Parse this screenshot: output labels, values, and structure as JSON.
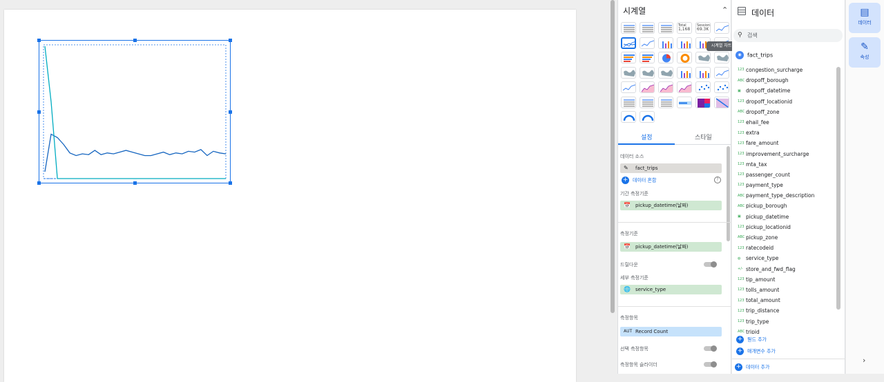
{
  "chart": {
    "chart_data": {
      "type": "line",
      "title": "",
      "xlabel": "",
      "ylabel": "",
      "series": [
        {
          "values": [
            8,
            52,
            48,
            40,
            30,
            27,
            29,
            28,
            33,
            28,
            30,
            29,
            31,
            33,
            31,
            29,
            27,
            27,
            29,
            31,
            28,
            30,
            29,
            32,
            31,
            34,
            27,
            32,
            30,
            29
          ]
        },
        {
          "values": [
            155,
            90,
            0,
            0,
            0,
            0,
            0,
            0,
            0,
            0,
            0,
            0,
            0,
            0,
            0,
            0,
            0,
            0,
            0,
            0,
            0,
            0,
            0,
            0,
            0,
            0,
            0,
            0,
            0,
            0
          ]
        }
      ],
      "colors": [
        "#1565c0",
        "#00acc1"
      ]
    }
  },
  "properties": {
    "title": "시계열",
    "tooltip": "시계열 차트",
    "chart_icons": {
      "scorecard_value_1": "1,168",
      "scorecard_value_2": "69.3K",
      "scorecard_label_1": "Total",
      "scorecard_label_2": "Sessions"
    },
    "tabs": {
      "setup": "설정",
      "style": "스타일"
    },
    "data_source_label": "데이터 소스",
    "data_source": "fact_trips",
    "blend_data": "데이터 혼합",
    "date_range_label": "기간 측정기준",
    "date_range_dimension": "pickup_datetime(날짜)",
    "dimension_label": "측정기준",
    "dimension": "pickup_datetime(날짜)",
    "drill_down_label": "드릴다운",
    "breakdown_label": "세부 측정기준",
    "breakdown": "service_type",
    "metric_label": "측정항목",
    "metric_type": "AUT",
    "metric": "Record Count",
    "optional_metrics_label": "선택 측정항목",
    "metric_sliders_label": "측정항목 슬라이더"
  },
  "data_panel": {
    "title": "데이터",
    "search_placeholder": "검색",
    "source": "fact_trips",
    "fields": [
      {
        "type": "123",
        "name": "congestion_surcharge"
      },
      {
        "type": "ABC",
        "name": "dropoff_borough"
      },
      {
        "type": "date",
        "name": "dropoff_datetime"
      },
      {
        "type": "123",
        "name": "dropoff_locationid"
      },
      {
        "type": "ABC",
        "name": "dropoff_zone"
      },
      {
        "type": "123",
        "name": "ehail_fee"
      },
      {
        "type": "123",
        "name": "extra"
      },
      {
        "type": "123",
        "name": "fare_amount"
      },
      {
        "type": "123",
        "name": "improvement_surcharge"
      },
      {
        "type": "123",
        "name": "mta_tax"
      },
      {
        "type": "123",
        "name": "passenger_count"
      },
      {
        "type": "123",
        "name": "payment_type"
      },
      {
        "type": "ABC",
        "name": "payment_type_description"
      },
      {
        "type": "ABC",
        "name": "pickup_borough"
      },
      {
        "type": "date",
        "name": "pickup_datetime"
      },
      {
        "type": "123",
        "name": "pickup_locationid"
      },
      {
        "type": "ABC",
        "name": "pickup_zone"
      },
      {
        "type": "123",
        "name": "ratecodeid"
      },
      {
        "type": "geo",
        "name": "service_type"
      },
      {
        "type": "bool",
        "name": "store_and_fwd_flag"
      },
      {
        "type": "123",
        "name": "tip_amount"
      },
      {
        "type": "123",
        "name": "tolls_amount"
      },
      {
        "type": "123",
        "name": "total_amount"
      },
      {
        "type": "123",
        "name": "trip_distance"
      },
      {
        "type": "123",
        "name": "trip_type"
      },
      {
        "type": "ABC",
        "name": "tripid"
      }
    ],
    "add_field": "필드 추가",
    "add_parameter": "매개변수 추가",
    "add_data": "데이터 추가"
  },
  "rail": {
    "data_label": "데이터",
    "properties_label": "속성"
  }
}
